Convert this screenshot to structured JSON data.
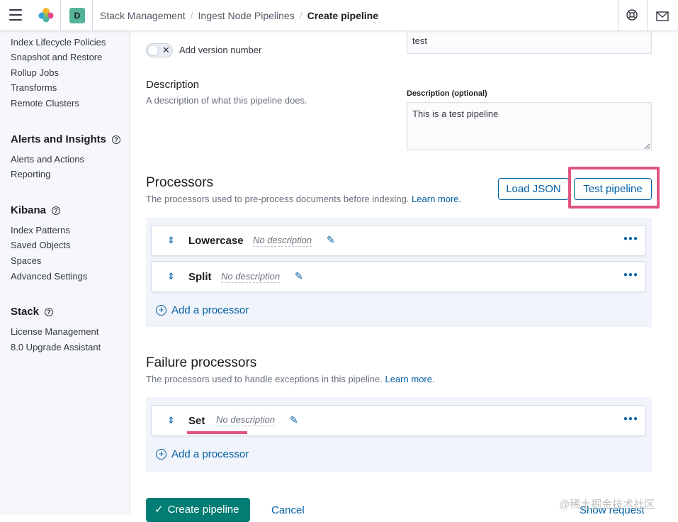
{
  "header": {
    "space_initial": "D",
    "breadcrumbs": [
      "Stack Management",
      "Ingest Node Pipelines",
      "Create pipeline"
    ]
  },
  "sidebar": {
    "ingest_links": [
      "Index Lifecycle Policies",
      "Snapshot and Restore",
      "Rollup Jobs",
      "Transforms",
      "Remote Clusters"
    ],
    "alerts_title": "Alerts and Insights",
    "alerts_links": [
      "Alerts and Actions",
      "Reporting"
    ],
    "kibana_title": "Kibana",
    "kibana_links": [
      "Index Patterns",
      "Saved Objects",
      "Spaces",
      "Advanced Settings"
    ],
    "stack_title": "Stack",
    "stack_links": [
      "License Management",
      "8.0 Upgrade Assistant"
    ]
  },
  "form": {
    "version_toggle_label": "Add version number",
    "name_value": "test",
    "description_title": "Description",
    "description_help": "A description of what this pipeline does.",
    "description_label": "Description (optional)",
    "description_value": "This is a test pipeline"
  },
  "processors": {
    "title": "Processors",
    "help": "The processors used to pre-process documents before indexing.",
    "learn_more": "Learn more.",
    "load_json": "Load JSON",
    "test_pipeline": "Test pipeline",
    "items": [
      {
        "name": "Lowercase",
        "desc": "No description"
      },
      {
        "name": "Split",
        "desc": "No description"
      }
    ],
    "add_label": "Add a processor"
  },
  "failure": {
    "title": "Failure processors",
    "help": "The processors used to handle exceptions in this pipeline.",
    "learn_more": "Learn more.",
    "items": [
      {
        "name": "Set",
        "desc": "No description"
      }
    ],
    "add_label": "Add a processor"
  },
  "footer": {
    "create": "Create pipeline",
    "cancel": "Cancel",
    "show_request": "Show request"
  },
  "watermark": "@稀土掘金技术社区",
  "colors": {
    "accent": "#0061a6",
    "primary_button": "#017d73",
    "highlight": "#e0557f"
  }
}
